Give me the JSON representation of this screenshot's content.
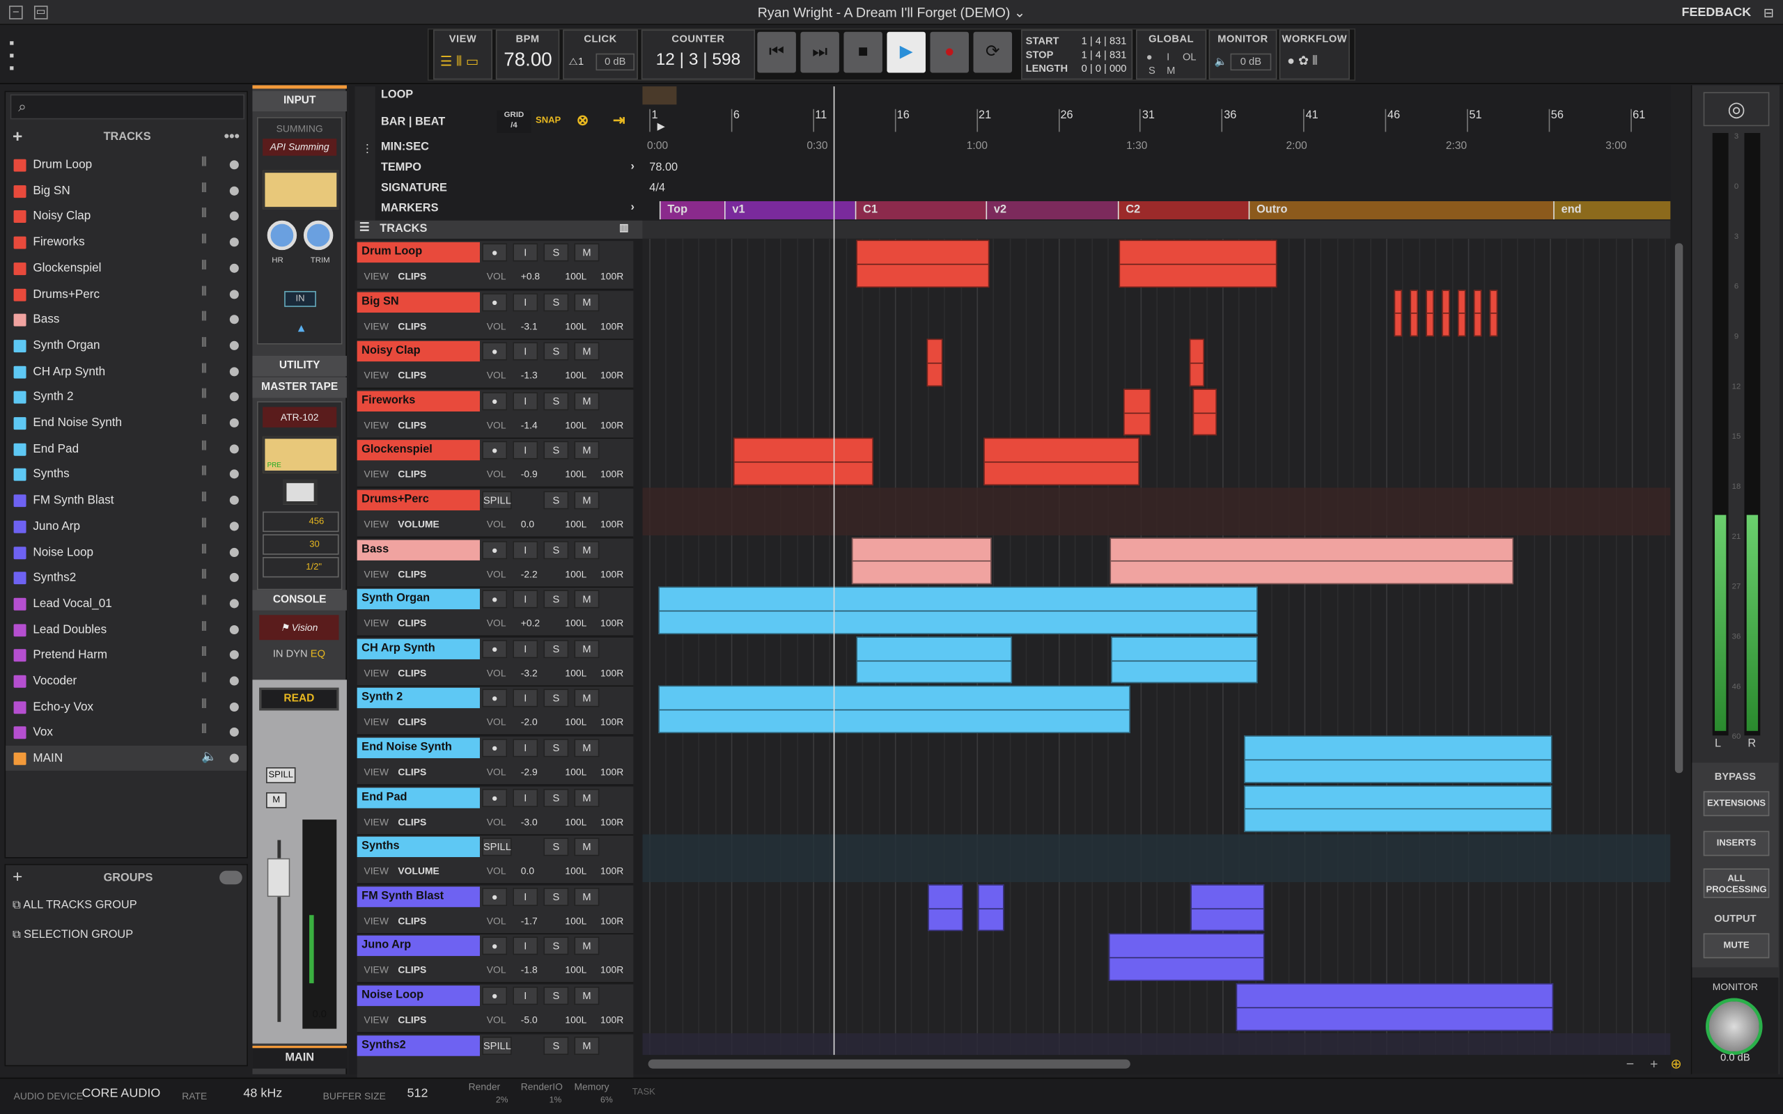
{
  "window": {
    "title": "Ryan Wright - A Dream I'll Forget (DEMO)",
    "feedback": "FEEDBACK"
  },
  "toolbar": {
    "view": "VIEW",
    "bpm_label": "BPM",
    "bpm": "78.00",
    "click_label": "CLICK",
    "click_db": "0 dB",
    "counter_label": "COUNTER",
    "counter": "12 | 3 | 598",
    "start_label": "START",
    "start": "1 | 4 | 831",
    "stop_label": "STOP",
    "stop": "1 | 4 | 831",
    "length_label": "LENGTH",
    "length": "0 | 0 | 000",
    "global_label": "GLOBAL",
    "global_s": "S",
    "global_i": "I",
    "global_ol": "OL",
    "global_m": "M",
    "monitor_label": "MONITOR",
    "monitor_db": "0 dB",
    "workflow_label": "WORKFLOW"
  },
  "browser": {
    "tracks_label": "TRACKS",
    "tracks": [
      {
        "name": "Drum Loop",
        "color": "#e84a3c"
      },
      {
        "name": "Big SN",
        "color": "#e84a3c"
      },
      {
        "name": "Noisy Clap",
        "color": "#e84a3c"
      },
      {
        "name": "Fireworks",
        "color": "#e84a3c"
      },
      {
        "name": "Glockenspiel",
        "color": "#e84a3c"
      },
      {
        "name": "Drums+Perc",
        "color": "#e84a3c"
      },
      {
        "name": "Bass",
        "color": "#f0a3a0"
      },
      {
        "name": "Synth Organ",
        "color": "#5ec8f4"
      },
      {
        "name": "CH Arp Synth",
        "color": "#5ec8f4"
      },
      {
        "name": "Synth 2",
        "color": "#5ec8f4"
      },
      {
        "name": "End Noise Synth",
        "color": "#5ec8f4"
      },
      {
        "name": "End Pad",
        "color": "#5ec8f4"
      },
      {
        "name": "Synths",
        "color": "#5ec8f4"
      },
      {
        "name": "FM Synth Blast",
        "color": "#6e62f2"
      },
      {
        "name": "Juno Arp",
        "color": "#6e62f2"
      },
      {
        "name": "Noise Loop",
        "color": "#6e62f2"
      },
      {
        "name": "Synths2",
        "color": "#6e62f2"
      },
      {
        "name": "Lead Vocal_01",
        "color": "#b54fd0"
      },
      {
        "name": "Lead Doubles",
        "color": "#b54fd0"
      },
      {
        "name": "Pretend Harm",
        "color": "#b54fd0"
      },
      {
        "name": "Vocoder",
        "color": "#b54fd0"
      },
      {
        "name": "Echo-y Vox",
        "color": "#b54fd0"
      },
      {
        "name": "Vox",
        "color": "#b54fd0"
      },
      {
        "name": "MAIN",
        "color": "#f39a3a"
      }
    ],
    "groups_label": "GROUPS",
    "groups": [
      "ALL TRACKS GROUP",
      "SELECTION GROUP"
    ]
  },
  "strip": {
    "input": "INPUT",
    "summing": "SUMMING",
    "api": "API Summing",
    "hr": "HR",
    "trim": "TRIM",
    "in": "IN",
    "utility": "UTILITY",
    "master_tape": "MASTER TAPE",
    "atr": "ATR-102",
    "v456": "456",
    "v30": "30",
    "vhalf": "1/2\"",
    "console": "CONSOLE",
    "vision": "Vision",
    "in2": "IN",
    "dyn": "DYN",
    "eq": "EQ",
    "read": "READ",
    "spill": "SPILL",
    "m": "M",
    "fader_val": "0.0",
    "main": "MAIN",
    "pre": "PRE",
    "scale": [
      "3",
      "0",
      "3",
      "6",
      "9",
      "12",
      "15",
      "18",
      "21",
      "27",
      "36",
      "46",
      "60"
    ]
  },
  "timeline": {
    "loop": "LOOP",
    "bar_beat": "BAR | BEAT",
    "grid": "GRID",
    "grid_val": "/4",
    "snap": "SNAP",
    "minsec": "MIN:SEC",
    "tempo": "TEMPO",
    "tempo_val": "78.00",
    "signature": "SIGNATURE",
    "signature_val": "4/4",
    "markers_label": "MARKERS",
    "tracks_label": "TRACKS",
    "bars": [
      "1",
      "6",
      "11",
      "16",
      "21",
      "26",
      "31",
      "36",
      "41",
      "46",
      "51",
      "56",
      "61"
    ],
    "times": [
      "0:00",
      "0:30",
      "1:00",
      "1:30",
      "2:00",
      "2:30",
      "3:00"
    ],
    "markers": [
      {
        "name": "Top",
        "color": "#8a2a8c"
      },
      {
        "name": "v1",
        "color": "#7a2a9c"
      },
      {
        "name": "C1",
        "color": "#8c2a4c"
      },
      {
        "name": "v2",
        "color": "#7c2a5c"
      },
      {
        "name": "C2",
        "color": "#9c2a2a"
      },
      {
        "name": "Outro",
        "color": "#8c5a1c"
      },
      {
        "name": "end",
        "color": "#8c6a1c"
      }
    ]
  },
  "tracks": [
    {
      "name": "Drum Loop",
      "color": "#e84a3c",
      "mode": "CLIPS",
      "vol": "+0.8"
    },
    {
      "name": "Big SN",
      "color": "#e84a3c",
      "mode": "CLIPS",
      "vol": "-3.1"
    },
    {
      "name": "Noisy Clap",
      "color": "#e84a3c",
      "mode": "CLIPS",
      "vol": "-1.3"
    },
    {
      "name": "Fireworks",
      "color": "#e84a3c",
      "mode": "CLIPS",
      "vol": "-1.4"
    },
    {
      "name": "Glockenspiel",
      "color": "#e84a3c",
      "mode": "CLIPS",
      "vol": "-0.9"
    },
    {
      "name": "Drums+Perc",
      "color": "#e84a3c",
      "mode": "VOLUME",
      "vol": "0.0",
      "folder": true
    },
    {
      "name": "Bass",
      "color": "#f0a3a0",
      "mode": "CLIPS",
      "vol": "-2.2"
    },
    {
      "name": "Synth Organ",
      "color": "#5ec8f4",
      "mode": "CLIPS",
      "vol": "+0.2"
    },
    {
      "name": "CH Arp Synth",
      "color": "#5ec8f4",
      "mode": "CLIPS",
      "vol": "-3.2"
    },
    {
      "name": "Synth 2",
      "color": "#5ec8f4",
      "mode": "CLIPS",
      "vol": "-2.0"
    },
    {
      "name": "End Noise Synth",
      "color": "#5ec8f4",
      "mode": "CLIPS",
      "vol": "-2.9"
    },
    {
      "name": "End Pad",
      "color": "#5ec8f4",
      "mode": "CLIPS",
      "vol": "-3.0"
    },
    {
      "name": "Synths",
      "color": "#5ec8f4",
      "mode": "VOLUME",
      "vol": "0.0",
      "folder": true
    },
    {
      "name": "FM Synth Blast",
      "color": "#6e62f2",
      "mode": "CLIPS",
      "vol": "-1.7"
    },
    {
      "name": "Juno Arp",
      "color": "#6e62f2",
      "mode": "CLIPS",
      "vol": "-1.8"
    },
    {
      "name": "Noise Loop",
      "color": "#6e62f2",
      "mode": "CLIPS",
      "vol": "-5.0"
    },
    {
      "name": "Synths2",
      "color": "#6e62f2",
      "mode": "",
      "vol": "",
      "folder": true
    }
  ],
  "track_labels": {
    "view": "VIEW",
    "vol": "VOL",
    "pan_l": "100L",
    "pan_r": "100R",
    "i": "I",
    "s": "S",
    "m": "M",
    "spill": "SPILL"
  },
  "right": {
    "l": "L",
    "r": "R",
    "bypass": "BYPASS",
    "extensions": "EXTENSIONS",
    "inserts": "INSERTS",
    "all_processing": "ALL PROCESSING",
    "output": "OUTPUT",
    "mute": "MUTE",
    "monitor": "MONITOR",
    "monitor_db": "0.0 dB"
  },
  "status": {
    "audio_device_label": "AUDIO DEVICE",
    "audio_device": "CORE AUDIO",
    "rate_label": "RATE",
    "rate": "48 kHz",
    "buffer_label": "BUFFER SIZE",
    "buffer": "512",
    "render": "Render",
    "renderio": "RenderIO",
    "memory": "Memory",
    "render_v": "2%",
    "renderio_v": "1%",
    "memory_v": "6%",
    "task": "TASK"
  }
}
